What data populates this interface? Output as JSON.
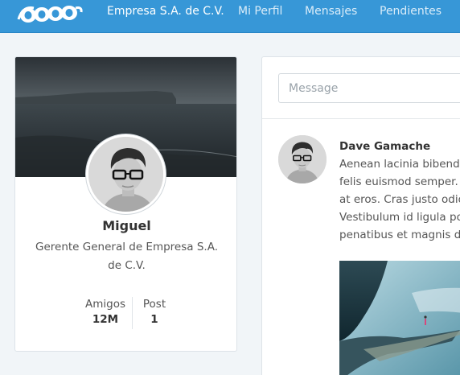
{
  "nav": {
    "items": [
      {
        "label": "Empresa S.A. de C.V."
      },
      {
        "label": "Mi Perfil"
      },
      {
        "label": "Mensajes"
      },
      {
        "label": "Pendientes"
      }
    ]
  },
  "profile": {
    "name": "Miguel",
    "role": "Gerente General de Empresa S.A. de C.V.",
    "stats": {
      "friends_label": "Amigos",
      "friends_value": "12M",
      "posts_label": "Post",
      "posts_value": "1"
    }
  },
  "composer": {
    "placeholder": "Message"
  },
  "post": {
    "author": "Dave Gamache",
    "lines": [
      "Aenean lacinia bibendum",
      "felis euismod semper. M",
      "at eros. Cras justo odio,",
      "Vestibulum id ligula port",
      "penatibus et magnis dis"
    ]
  },
  "colors": {
    "nav_bg": "#3797d7",
    "page_bg": "#f1f5f8"
  },
  "icons": {
    "logo": "bootstrap-logo-circles",
    "avatar": "user-photo-avatar"
  }
}
